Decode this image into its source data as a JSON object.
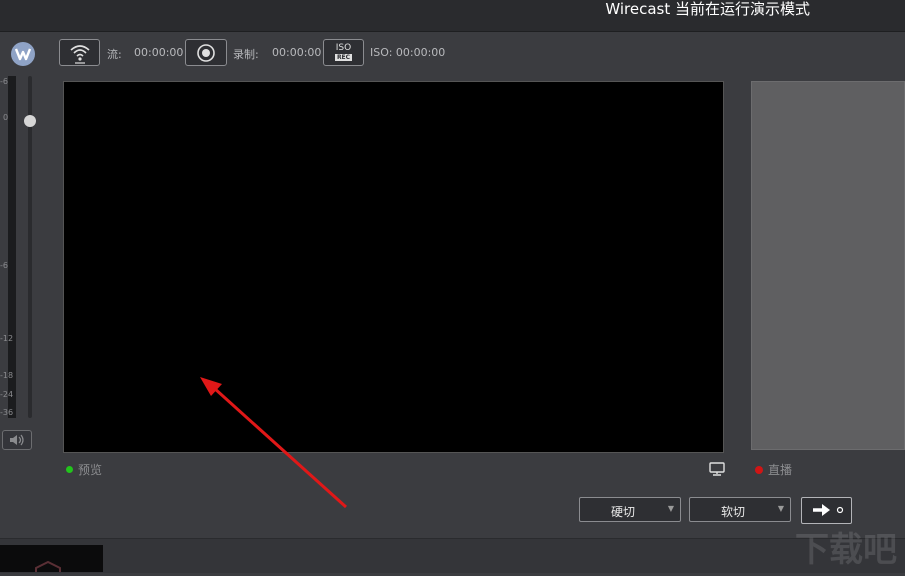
{
  "window": {
    "title": "Wirecast 当前在运行演示模式"
  },
  "toolbar": {
    "stream_label": "流:",
    "stream_time": "00:00:00",
    "record_label": "录制:",
    "record_time": "00:00:00",
    "iso_top": "ISO",
    "iso_bottom": "REC",
    "iso_label": "ISO: 00:00:00"
  },
  "audio": {
    "scale": [
      "-6",
      "0",
      "-6",
      "-12",
      "-18",
      "-24",
      "-36"
    ]
  },
  "preview": {
    "label": "预览",
    "indicator_color": "#22c41c"
  },
  "live": {
    "label": "直播",
    "indicator_color": "#d01515"
  },
  "transitions": {
    "cut": "硬切",
    "smooth": "软切"
  },
  "colors": {
    "annotation_arrow": "#e01818",
    "background": "#3b3c40"
  },
  "watermark": "下载吧"
}
